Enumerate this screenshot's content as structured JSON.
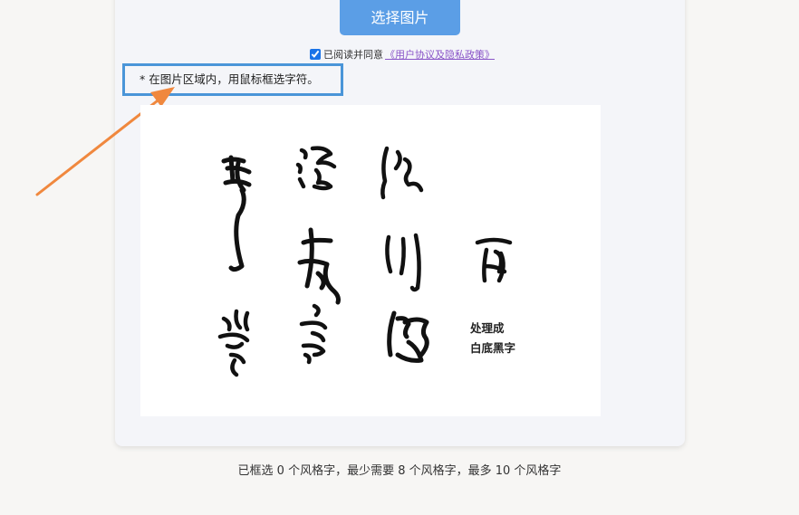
{
  "upload": {
    "select_label": "选择图片"
  },
  "agreement": {
    "checked": true,
    "prefix": "已阅读并同意",
    "link": "《用户协议及隐私政策》"
  },
  "hint": "* 在图片区域内，用鼠标框选字符。",
  "image": {
    "note_line1": "处理成",
    "note_line2": "白底黑字"
  },
  "status": "已框选 0 个风格字，最少需要 8 个风格字，最多 10 个风格字",
  "colors": {
    "button": "#5b9ee6",
    "hint_border": "#4a95d8",
    "arrow": "#f0883e",
    "link": "#8a55c8"
  }
}
